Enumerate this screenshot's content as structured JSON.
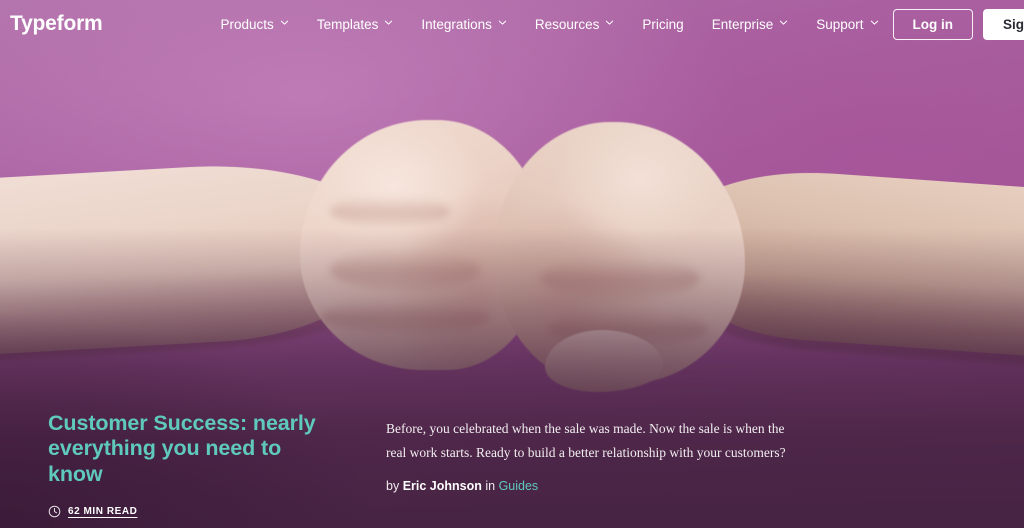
{
  "meta": {
    "brand_color": "#a05a9a",
    "accent_color": "#5fc9be",
    "overlay_color": "#4e2a4a"
  },
  "navbar": {
    "brand": "Typeform",
    "links": [
      {
        "label": "Products",
        "has_dropdown": true,
        "icon": "chevron-down-icon"
      },
      {
        "label": "Templates",
        "has_dropdown": true,
        "icon": "chevron-down-icon"
      },
      {
        "label": "Integrations",
        "has_dropdown": true,
        "icon": "chevron-down-icon"
      },
      {
        "label": "Resources",
        "has_dropdown": true,
        "icon": "chevron-down-icon"
      },
      {
        "label": "Pricing",
        "has_dropdown": false,
        "icon": ""
      },
      {
        "label": "Enterprise",
        "has_dropdown": true,
        "icon": "chevron-down-icon"
      },
      {
        "label": "Support",
        "has_dropdown": true,
        "icon": "chevron-down-icon"
      }
    ],
    "login_label": "Log in",
    "signup_label": "Sign up"
  },
  "hero": {
    "image_alt": "two fists bumping against a purple background",
    "headline": "Customer Success: nearly everything you need to know",
    "read_time": "62 MIN READ",
    "read_time_icon": "clock-icon",
    "lede": "Before, you celebrated when the sale was made. Now the sale is when the real work starts. Ready to build a better relationship with your customers?",
    "byline_prefix": "by",
    "author": "Eric Johnson",
    "byline_join": "in",
    "category": "Guides"
  }
}
